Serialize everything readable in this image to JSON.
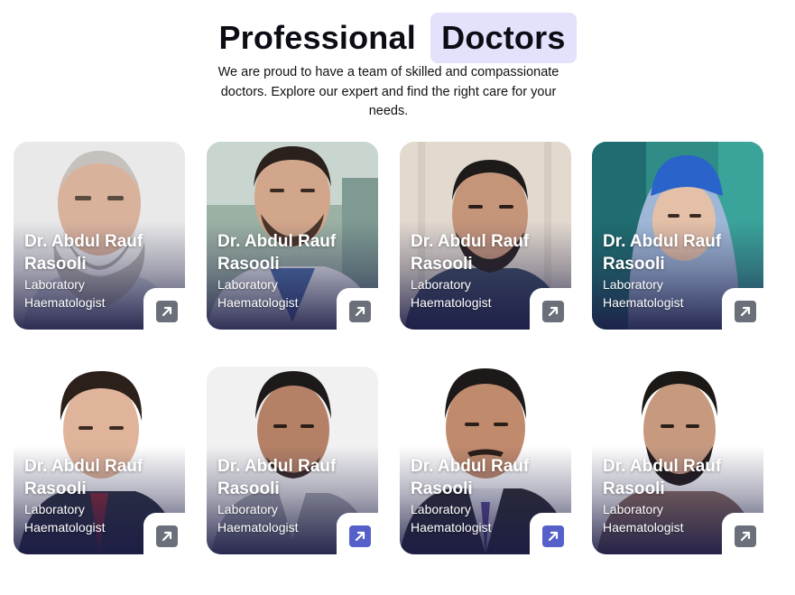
{
  "section": {
    "title_plain": "Professional",
    "title_highlight": "Doctors",
    "subtitle": "We are proud to have a team of skilled and compassionate doctors. Explore our expert and find the right care for your needs."
  },
  "doctors": [
    {
      "name": "Dr. Abdul Rauf Rasooli",
      "department": "Laboratory",
      "role": "Haematologist"
    },
    {
      "name": "Dr. Abdul Rauf Rasooli",
      "department": "Laboratory",
      "role": "Haematologist"
    },
    {
      "name": "Dr. Abdul Rauf Rasooli",
      "department": "Laboratory",
      "role": "Haematologist"
    },
    {
      "name": "Dr. Abdul Rauf Rasooli",
      "department": "Laboratory",
      "role": "Haematologist"
    },
    {
      "name": "Dr. Abdul Rauf Rasooli",
      "department": "Laboratory",
      "role": "Haematologist"
    },
    {
      "name": "Dr. Abdul Rauf Rasooli",
      "department": "Laboratory",
      "role": "Haematologist"
    },
    {
      "name": "Dr. Abdul Rauf Rasooli",
      "department": "Laboratory",
      "role": "Haematologist"
    },
    {
      "name": "Dr. Abdul Rauf Rasooli",
      "department": "Laboratory",
      "role": "Haematologist"
    }
  ],
  "colors": {
    "highlight_bg": "#e3e1fb",
    "arrow_button": "#6b6f79",
    "arrow_button_active": "#5560c8"
  },
  "icons": {
    "card_link": "arrow-up-right-icon"
  }
}
